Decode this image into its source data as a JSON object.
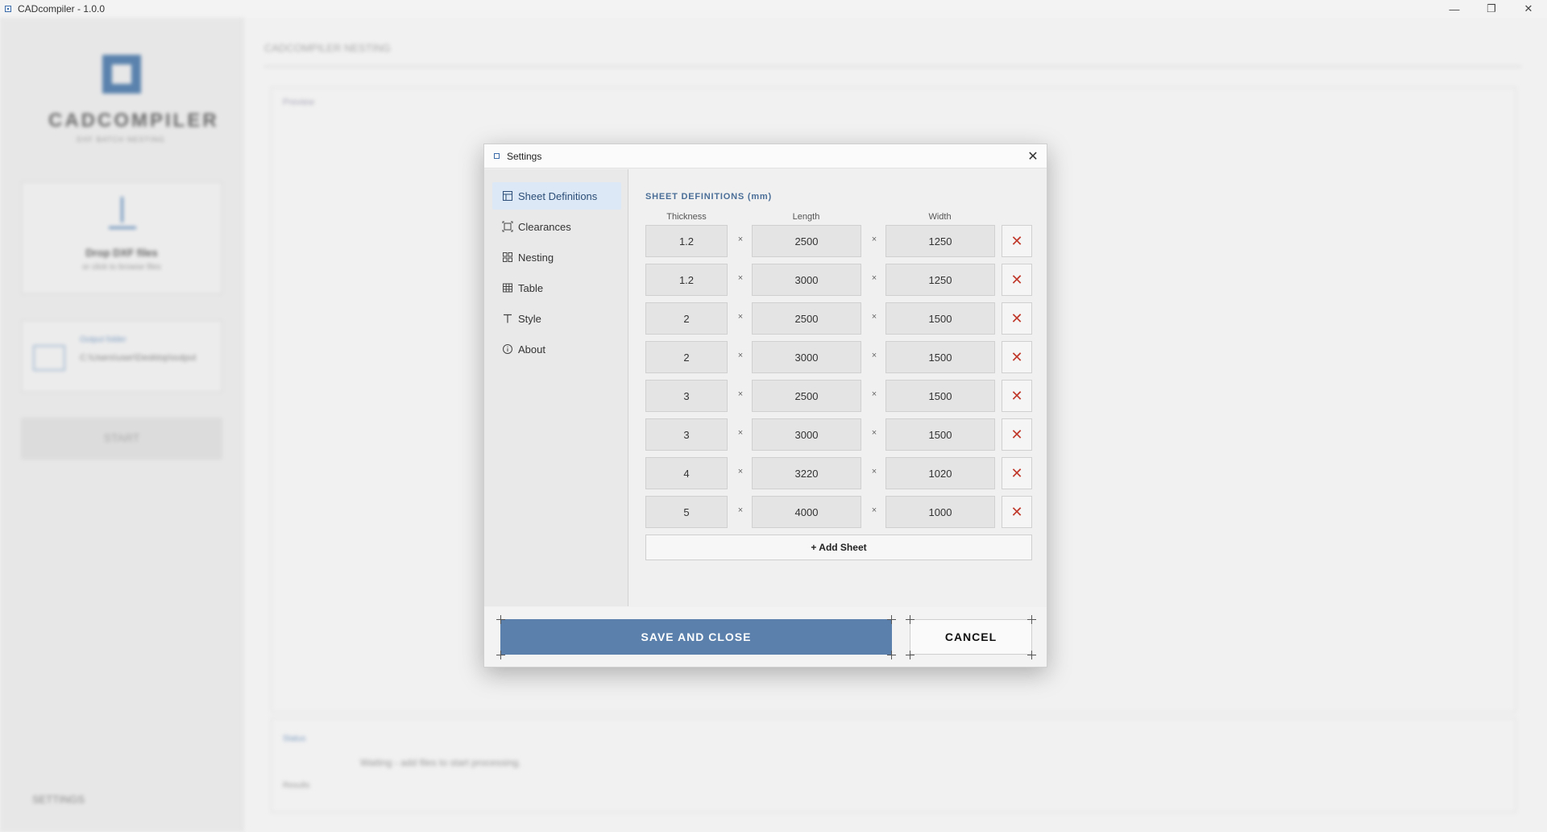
{
  "window": {
    "title": "CADcompiler - 1.0.0",
    "controls": {
      "minimize": "—",
      "restore": "❐",
      "close": "✕"
    }
  },
  "background": {
    "logo_text": "CADCOMPILER",
    "logo_sub": "DXF BATCH NESTING",
    "upload_title": "Drop DXF files",
    "upload_sub": "or click to browse files",
    "folder_label": "Output folder",
    "folder_path": "C:\\Users\\user\\Desktop\\output",
    "start_label": "START",
    "settings_label": "SETTINGS",
    "main_title": "CADCOMPILER NESTING",
    "panel_label": "Preview",
    "bottom_label1": "Status",
    "bottom_label2": "Results",
    "bottom_status": "Waiting - add files to start processing."
  },
  "dialog": {
    "title": "Settings",
    "close_glyph": "✕",
    "nav": [
      {
        "label": "Sheet Definitions",
        "icon": "sheet-icon",
        "active": true
      },
      {
        "label": "Clearances",
        "icon": "clearance-icon",
        "active": false
      },
      {
        "label": "Nesting",
        "icon": "nesting-grid-icon",
        "active": false
      },
      {
        "label": "Table",
        "icon": "table-icon",
        "active": false
      },
      {
        "label": "Style",
        "icon": "text-style-icon",
        "active": false
      },
      {
        "label": "About",
        "icon": "info-icon",
        "active": false
      }
    ],
    "section_title": "SHEET DEFINITIONS (mm)",
    "columns": {
      "thickness": "Thickness",
      "length": "Length",
      "width": "Width"
    },
    "separator": "×",
    "delete_glyph": "✕",
    "sheets": [
      {
        "thickness": "1.2",
        "length": "2500",
        "width": "1250"
      },
      {
        "thickness": "1.2",
        "length": "3000",
        "width": "1250"
      },
      {
        "thickness": "2",
        "length": "2500",
        "width": "1500"
      },
      {
        "thickness": "2",
        "length": "3000",
        "width": "1500"
      },
      {
        "thickness": "3",
        "length": "2500",
        "width": "1500"
      },
      {
        "thickness": "3",
        "length": "3000",
        "width": "1500"
      },
      {
        "thickness": "4",
        "length": "3220",
        "width": "1020"
      },
      {
        "thickness": "5",
        "length": "4000",
        "width": "1000"
      }
    ],
    "add_sheet_label": "+ Add Sheet",
    "save_label": "SAVE AND CLOSE",
    "cancel_label": "CANCEL"
  },
  "colors": {
    "accent": "#5a80ab",
    "nav_active_bg": "#dce8f5",
    "delete_red": "#c0392b"
  }
}
